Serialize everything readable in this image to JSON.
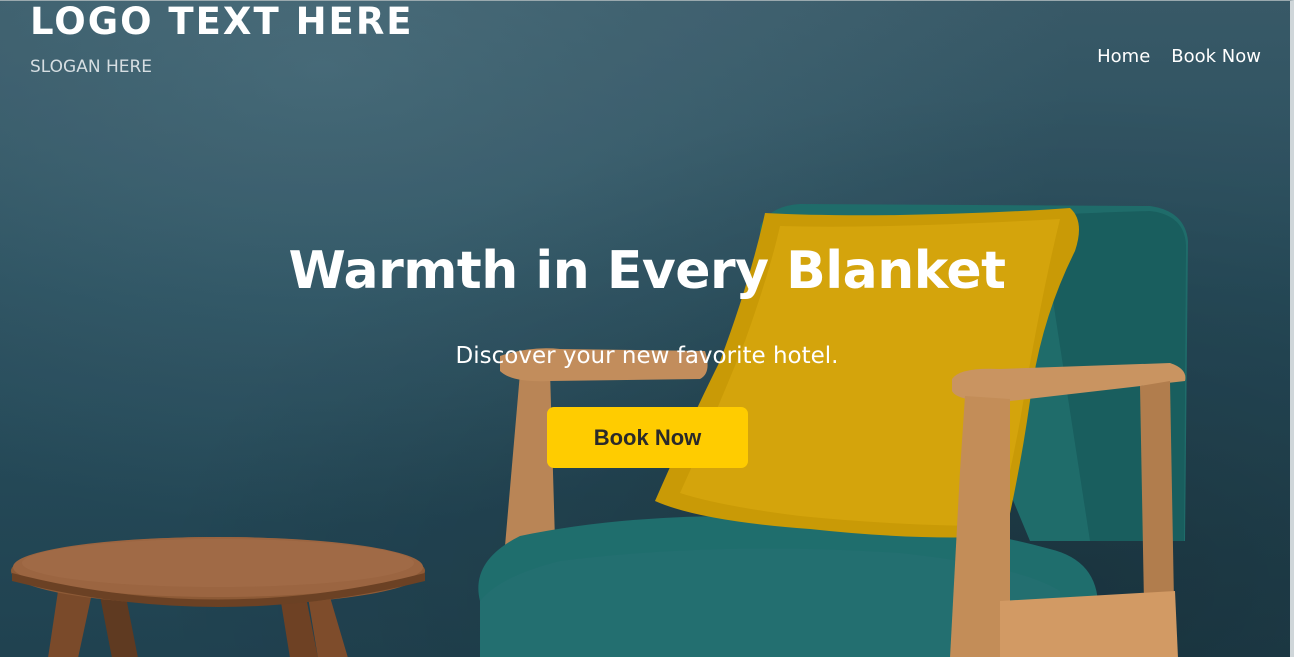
{
  "header": {
    "logo_text": "LOGO TEXT HERE",
    "slogan": "SLOGAN HERE"
  },
  "nav": {
    "items": [
      {
        "label": "Home"
      },
      {
        "label": "Book Now"
      }
    ]
  },
  "hero": {
    "headline": "Warmth in Every Blanket",
    "subheadline": "Discover your new favorite hotel.",
    "cta_label": "Book Now",
    "background_image": "armchair-with-yellow-cushion-and-side-table",
    "colors": {
      "wall": "#2b5363",
      "button": "#ffcc00",
      "button_text": "#2a2a2a",
      "text": "#ffffff"
    }
  }
}
